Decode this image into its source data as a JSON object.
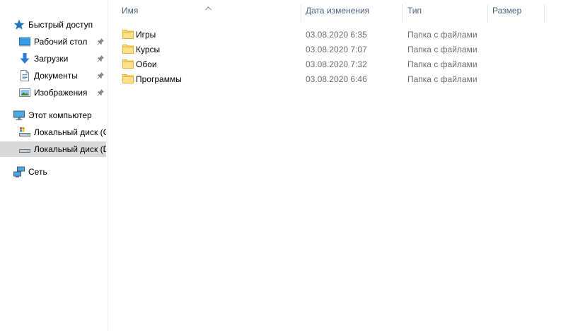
{
  "navigation": {
    "items": [
      {
        "label": "Быстрый доступ",
        "icon": "star-icon"
      },
      {
        "label": "Рабочий стол",
        "icon": "desktop-icon",
        "pinned": true
      },
      {
        "label": "Загрузки",
        "icon": "download-arrow-icon",
        "pinned": true
      },
      {
        "label": "Документы",
        "icon": "document-icon",
        "pinned": true
      },
      {
        "label": "Изображения",
        "icon": "pictures-icon",
        "pinned": true
      },
      {
        "label": "Этот компьютер",
        "icon": "computer-icon"
      },
      {
        "label": "Локальный диск (C",
        "icon": "system-drive-icon"
      },
      {
        "label": "Локальный диск (D",
        "icon": "drive-icon",
        "selected": true
      },
      {
        "label": "Сеть",
        "icon": "network-icon"
      }
    ]
  },
  "columns": {
    "name": "Имя",
    "date": "Дата изменения",
    "type": "Тип",
    "size": "Размер"
  },
  "files": [
    {
      "name": "Игры",
      "date": "03.08.2020 6:35",
      "type": "Папка с файлами",
      "icon": "folder-icon"
    },
    {
      "name": "Курсы",
      "date": "03.08.2020 7:07",
      "type": "Папка с файлами",
      "icon": "folder-icon"
    },
    {
      "name": "Обои",
      "date": "03.08.2020 7:32",
      "type": "Папка с файлами",
      "icon": "folder-icon"
    },
    {
      "name": "Программы",
      "date": "03.08.2020 6:46",
      "type": "Папка с файлами",
      "icon": "folder-icon"
    }
  ],
  "colors": {
    "header_text": "#4c607a",
    "selected_bg": "#d9d9d9",
    "folder_yellow": "#ffd766",
    "accent_blue": "#1e73be"
  }
}
